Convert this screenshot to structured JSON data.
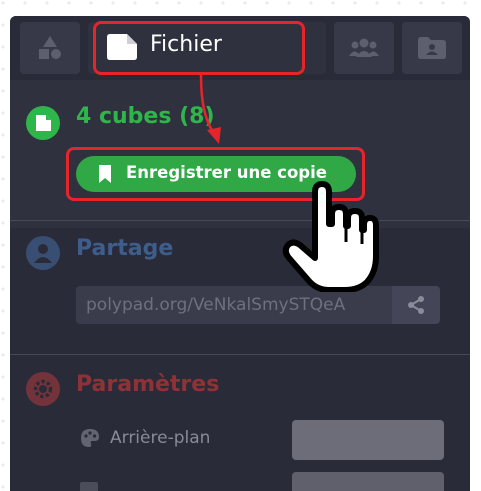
{
  "tabs": [
    {
      "icon": "shapes-icon",
      "label": ""
    },
    {
      "icon": "file-icon",
      "label": "Fichier"
    },
    {
      "icon": "users-icon",
      "label": ""
    },
    {
      "icon": "folder-user-icon",
      "label": ""
    }
  ],
  "file_section": {
    "title": "4 cubes (8)",
    "save_label": "Enregistrer une copie"
  },
  "share_section": {
    "title": "Partage",
    "url": "polypad.org/VeNkalSmySTQeA"
  },
  "settings_section": {
    "title": "Paramètres",
    "background_label": "Arrière-plan"
  },
  "colors": {
    "accent_green": "#2fa845",
    "highlight_red": "#e5252a",
    "panel_bg": "#2a2b38"
  }
}
